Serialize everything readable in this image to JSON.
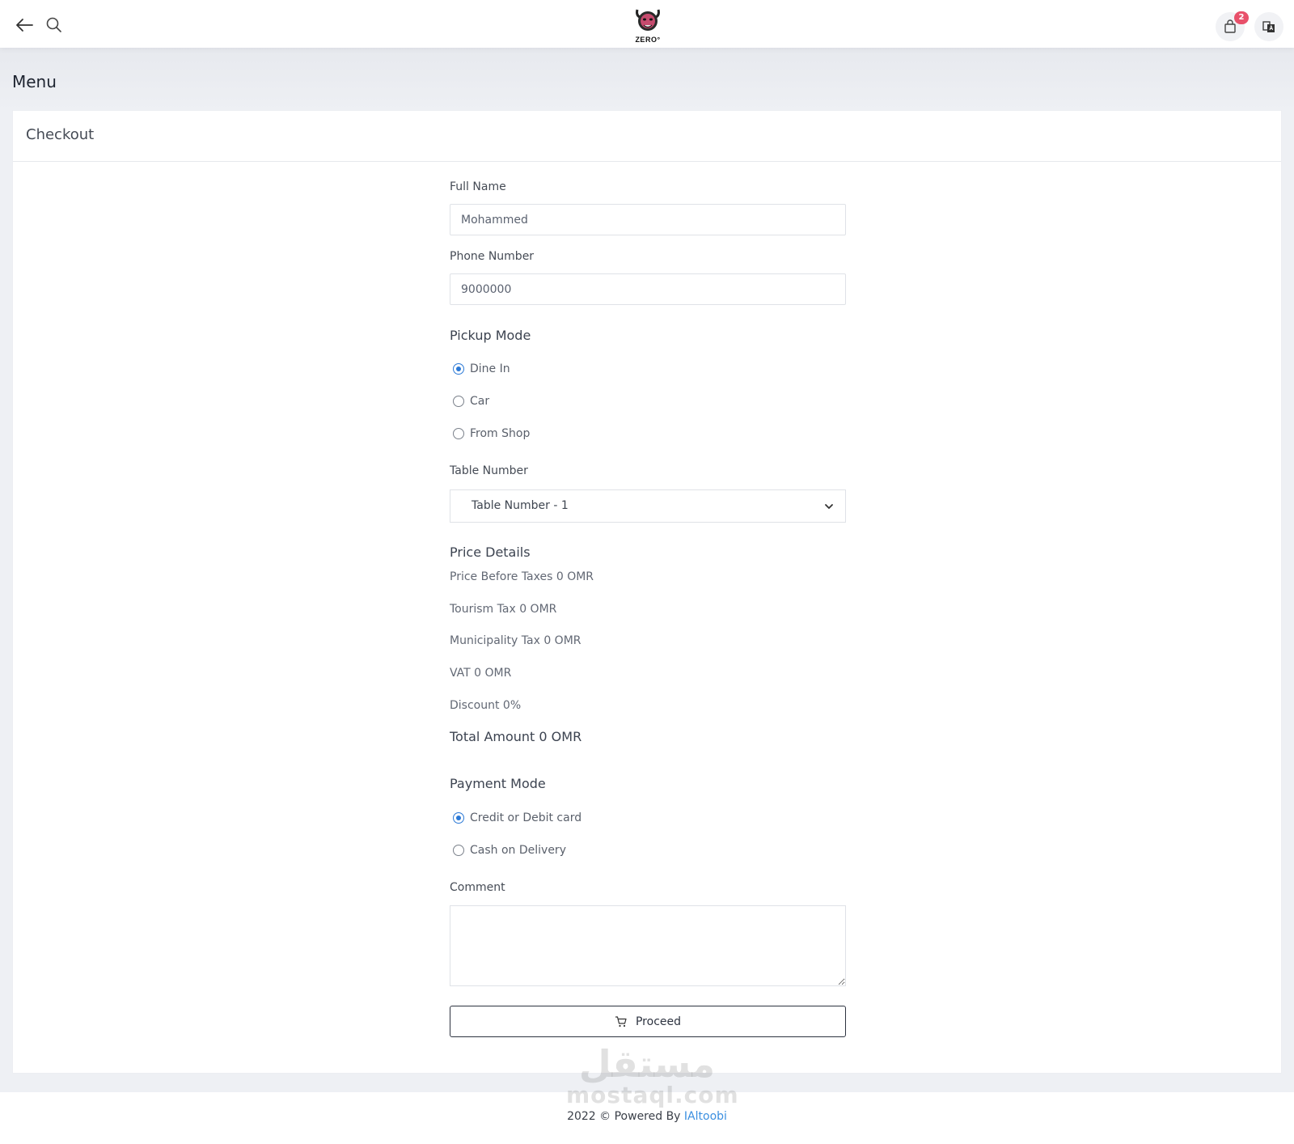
{
  "header": {
    "logo_text": "ZERO°",
    "cart_count": "2",
    "icons": [
      "back-arrow-icon",
      "search-icon",
      "shopping-bag-icon",
      "language-icon"
    ]
  },
  "page": {
    "heading": "Menu"
  },
  "checkout": {
    "title": "Checkout",
    "full_name": {
      "label": "Full Name",
      "value": "Mohammed"
    },
    "phone": {
      "label": "Phone Number",
      "value": "9000000"
    },
    "pickup": {
      "title": "Pickup Mode",
      "options": [
        {
          "label": "Dine In",
          "checked": true
        },
        {
          "label": "Car",
          "checked": false
        },
        {
          "label": "From Shop",
          "checked": false
        }
      ]
    },
    "table": {
      "label": "Table Number",
      "value": "Table Number - 1"
    },
    "price": {
      "title": "Price Details",
      "before_taxes": "Price Before Taxes 0 OMR",
      "tourism_tax": "Tourism Tax 0 OMR",
      "municipality_tax": "Municipality Tax 0 OMR",
      "vat": "VAT 0 OMR",
      "discount": "Discount 0%",
      "total": "Total Amount 0 OMR"
    },
    "payment": {
      "title": "Payment Mode",
      "options": [
        {
          "label": "Credit or Debit card",
          "checked": true
        },
        {
          "label": "Cash on Delivery",
          "checked": false
        }
      ]
    },
    "comment": {
      "label": "Comment",
      "value": ""
    },
    "proceed_label": "Proceed"
  },
  "footer": {
    "prefix": "2022 © Powered By ",
    "link_text": "IAltoobi",
    "watermark_ar": "مستقل",
    "watermark_en": "mostaql.com"
  },
  "colors": {
    "accent": "#2b79d6",
    "badge": "#e8506a",
    "link": "#3b8fe0"
  }
}
